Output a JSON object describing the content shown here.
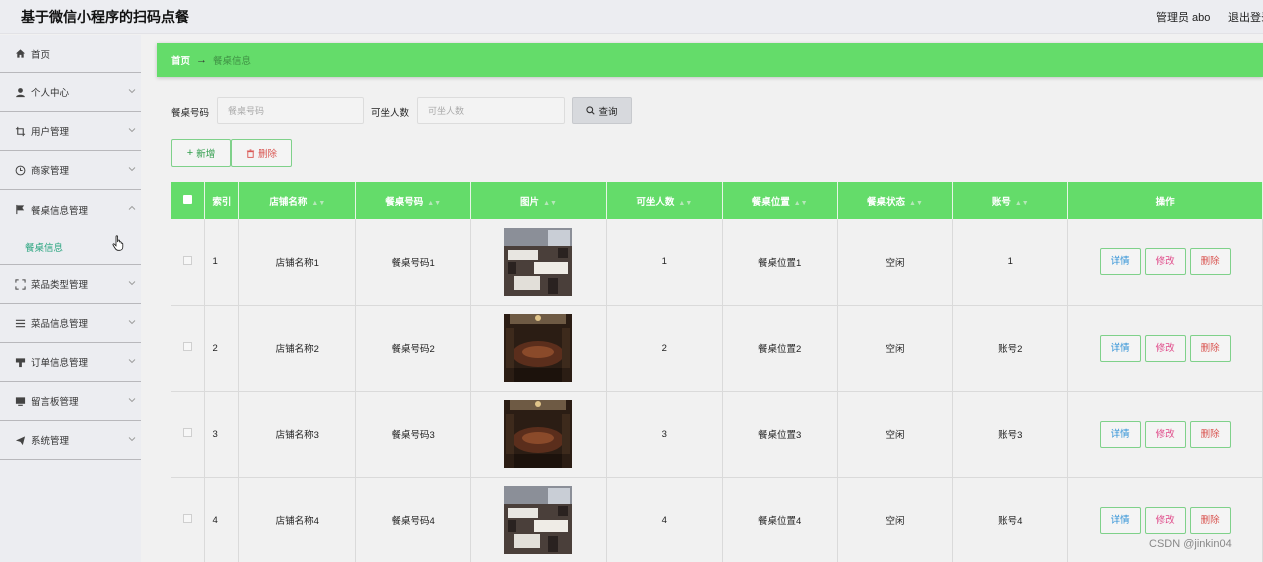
{
  "header": {
    "title": "基于微信小程序的扫码点餐",
    "admin_label": "管理员 abo",
    "logout_label": "退出登录"
  },
  "sidebar": {
    "items": [
      {
        "label": "首页",
        "icon": "home-icon",
        "chevron": false
      },
      {
        "label": "个人中心",
        "icon": "user-icon",
        "chevron": true
      },
      {
        "label": "用户管理",
        "icon": "crop-icon",
        "chevron": true
      },
      {
        "label": "商家管理",
        "icon": "clock-icon",
        "chevron": true
      },
      {
        "label": "餐桌信息管理",
        "icon": "flag-icon",
        "chevron": true,
        "expanded": true
      },
      {
        "label": "菜品类型管理",
        "icon": "scan-icon",
        "chevron": true
      },
      {
        "label": "菜品信息管理",
        "icon": "list-icon",
        "chevron": true
      },
      {
        "label": "订单信息管理",
        "icon": "stamp-icon",
        "chevron": true
      },
      {
        "label": "留言板管理",
        "icon": "monitor-icon",
        "chevron": true
      },
      {
        "label": "系统管理",
        "icon": "send-icon",
        "chevron": true
      }
    ],
    "sub_item": "餐桌信息"
  },
  "breadcrumb": {
    "home": "首页",
    "arrow": "→",
    "current": "餐桌信息"
  },
  "search": {
    "table_label": "餐桌号码",
    "table_placeholder": "餐桌号码",
    "seats_label": "可坐人数",
    "seats_placeholder": "可坐人数",
    "button": "查询"
  },
  "actions": {
    "add": "新增",
    "delete": "删除"
  },
  "table": {
    "columns": [
      "索引",
      "店铺名称",
      "餐桌号码",
      "图片",
      "可坐人数",
      "餐桌位置",
      "餐桌状态",
      "账号",
      "操作"
    ],
    "rows": [
      {
        "index": "1",
        "store": "店铺名称1",
        "table_no": "餐桌号码1",
        "photo": "bright",
        "seats": "1",
        "location": "餐桌位置1",
        "status": "空闲",
        "account": "1"
      },
      {
        "index": "2",
        "store": "店铺名称2",
        "table_no": "餐桌号码2",
        "photo": "dark",
        "seats": "2",
        "location": "餐桌位置2",
        "status": "空闲",
        "account": "账号2"
      },
      {
        "index": "3",
        "store": "店铺名称3",
        "table_no": "餐桌号码3",
        "photo": "dark",
        "seats": "3",
        "location": "餐桌位置3",
        "status": "空闲",
        "account": "账号3"
      },
      {
        "index": "4",
        "store": "店铺名称4",
        "table_no": "餐桌号码4",
        "photo": "bright",
        "seats": "4",
        "location": "餐桌位置4",
        "status": "空闲",
        "account": "账号4"
      }
    ],
    "ops": {
      "detail": "详情",
      "edit": "修改",
      "delete": "删除"
    }
  },
  "watermark": "CSDN @jinkin04",
  "colors": {
    "accent": "#64dc6a",
    "sidebar_bg": "#ecedf1",
    "active_text": "#27a47e"
  }
}
